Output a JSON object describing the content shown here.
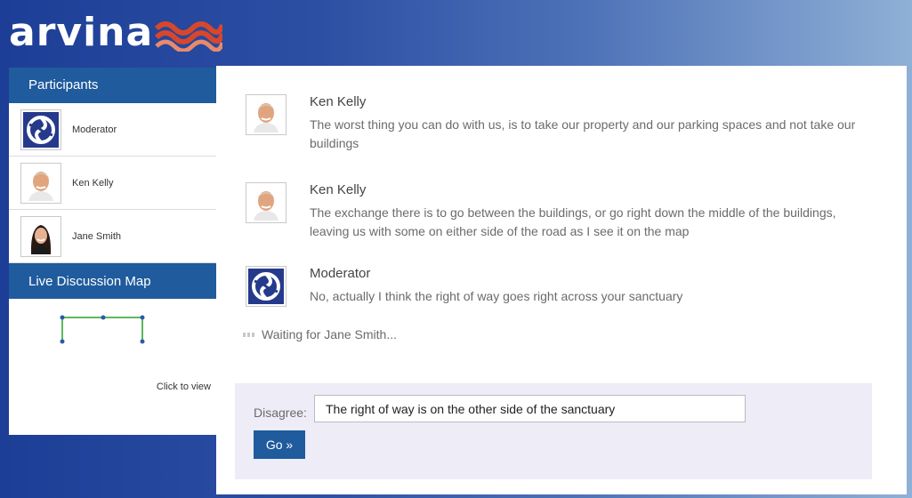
{
  "app": {
    "logo_text": "arvina",
    "logo_icon": "wave-icon"
  },
  "sidebar": {
    "participants_title": "Participants",
    "participants": [
      {
        "name": "Moderator",
        "avatar": "moderator-logo-icon"
      },
      {
        "name": "Ken Kelly",
        "avatar": "man-avatar-icon"
      },
      {
        "name": "Jane Smith",
        "avatar": "woman-avatar-icon"
      }
    ],
    "map_title": "Live Discussion Map",
    "click_to_view": "Click to view"
  },
  "messages": [
    {
      "name": "Ken Kelly",
      "text": "The worst thing you can do with us, is to take our property and our parking spaces and not take our buildings"
    },
    {
      "name": "Ken Kelly",
      "text": "The exchange there is to go between the buildings, or go right down the middle of the buildings, leaving us with some on either side of the road as I see it on the map"
    },
    {
      "name": "Moderator",
      "text": "No, actually I think the right of way goes right across your sanctuary"
    }
  ],
  "waiting_text": "Waiting for Jane Smith...",
  "reply": {
    "label": "Disagree:",
    "input_value": "The right of way is on the other side of the sanctuary",
    "go_label": "Go »"
  },
  "colors": {
    "header_blue": "#1f5b9d",
    "wave_red": "#d9472b",
    "map_green": "#5cb85c",
    "map_node": "#2a5aa8"
  }
}
